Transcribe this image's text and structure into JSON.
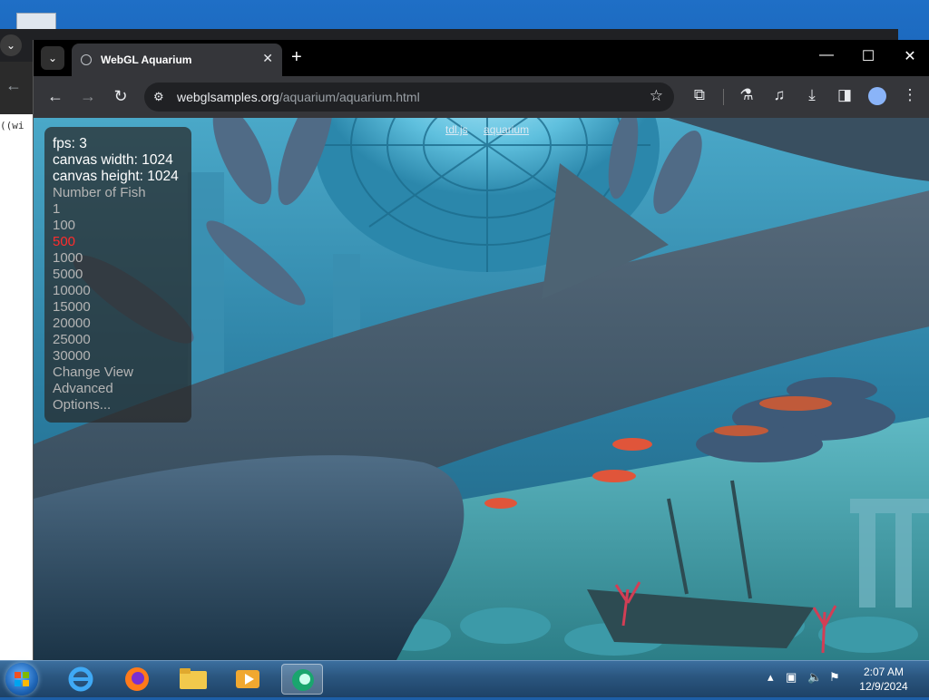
{
  "browser": {
    "tab_title": "WebGL Aquarium",
    "url_host": "webglsamples.org",
    "url_path": "/aquarium/aquarium.html"
  },
  "background_window": {
    "code_fragment": "((wi"
  },
  "page": {
    "top_links": [
      "tdl.js",
      "aquarium"
    ],
    "stats": {
      "fps": "fps: 3",
      "canvas_width": "canvas width: 1024",
      "canvas_height": "canvas height: 1024"
    },
    "fish_menu_label": "Number of Fish",
    "fish_options": [
      "1",
      "100",
      "500",
      "1000",
      "5000",
      "10000",
      "15000",
      "20000",
      "25000",
      "30000"
    ],
    "selected_fish": "500",
    "change_view": "Change View",
    "advanced": "Advanced",
    "options": "Options..."
  },
  "taskbar": {
    "apps": [
      "internet-explorer",
      "firefox",
      "file-explorer",
      "media-player",
      "browser-active"
    ],
    "time": "2:07 AM",
    "date": "12/9/2024"
  },
  "colors": {
    "selected_option": "#ff2c2c",
    "water": "#2d7fa4"
  }
}
